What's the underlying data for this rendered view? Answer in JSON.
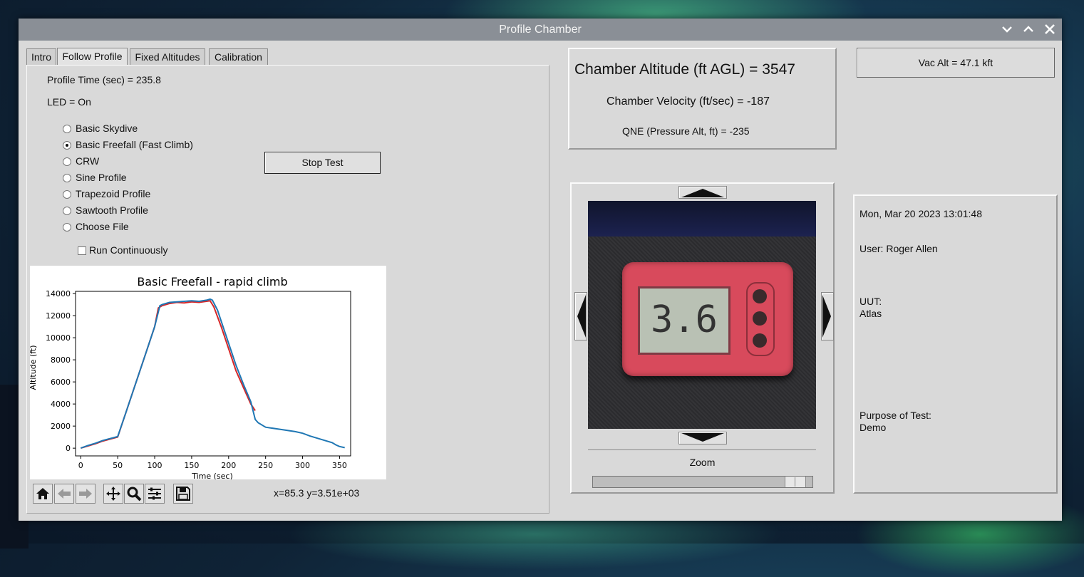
{
  "window": {
    "title": "Profile Chamber"
  },
  "tabs": [
    {
      "label": "Intro"
    },
    {
      "label": "Follow Profile"
    },
    {
      "label": "Fixed Altitudes"
    },
    {
      "label": "Calibration"
    }
  ],
  "profile": {
    "time_text": "Profile Time (sec) = 235.8",
    "led_text": "LED = On",
    "options": [
      "Basic Skydive",
      "Basic Freefall (Fast Climb)",
      "CRW",
      "Sine Profile",
      "Trapezoid Profile",
      "Sawtooth Profile",
      "Choose File"
    ],
    "selected_index": 1,
    "run_continuously_label": "Run Continuously",
    "run_continuously_checked": false,
    "stop_button": "Stop Test"
  },
  "chart_data": {
    "type": "line",
    "title": "Basic Freefall - rapid climb",
    "xlabel": "Time (sec)",
    "ylabel": "Altitude (ft)",
    "xlim": [
      -7,
      365
    ],
    "ylim": [
      -700,
      14200
    ],
    "xticks": [
      0,
      50,
      100,
      150,
      200,
      250,
      300,
      350
    ],
    "yticks": [
      0,
      2000,
      4000,
      6000,
      8000,
      10000,
      12000,
      14000
    ],
    "series": [
      {
        "color": "#d62728",
        "x": [
          0,
          10,
          20,
          30,
          50,
          60,
          70,
          80,
          90,
          100,
          105,
          110,
          120,
          130,
          140,
          150,
          160,
          170,
          175,
          180,
          190,
          200,
          210,
          220,
          230,
          236
        ],
        "y": [
          0,
          200,
          400,
          650,
          1000,
          3000,
          5000,
          7000,
          9000,
          11000,
          12700,
          12900,
          13100,
          13200,
          13150,
          13250,
          13200,
          13300,
          13350,
          12800,
          11000,
          9000,
          7000,
          5500,
          4000,
          3400
        ]
      },
      {
        "color": "#1f77b4",
        "x": [
          0,
          10,
          20,
          30,
          50,
          60,
          70,
          80,
          90,
          100,
          107,
          110,
          120,
          130,
          140,
          150,
          160,
          170,
          175,
          178,
          185,
          190,
          200,
          210,
          220,
          230,
          236,
          240,
          250,
          270,
          290,
          300,
          310,
          320,
          330,
          340,
          345,
          350,
          357
        ],
        "y": [
          0,
          250,
          450,
          700,
          1050,
          3000,
          5000,
          7000,
          9000,
          11000,
          12900,
          13000,
          13200,
          13250,
          13300,
          13350,
          13300,
          13400,
          13500,
          13400,
          12500,
          11500,
          9500,
          7500,
          5800,
          4200,
          2600,
          2300,
          1900,
          1700,
          1500,
          1350,
          1100,
          900,
          700,
          500,
          300,
          150,
          50
        ]
      }
    ]
  },
  "plot_toolbar": {
    "coords": "x=85.3 y=3.51e+03",
    "tools": [
      "home-icon",
      "back-arrow-icon",
      "forward-arrow-icon",
      "pan-icon",
      "zoom-icon",
      "configure-subplots-icon",
      "save-icon"
    ]
  },
  "chamber": {
    "altitude_text": "Chamber Altitude (ft AGL) =  3547",
    "velocity_text": "Chamber Velocity (ft/sec) =  -187",
    "qne_text": "QNE (Pressure Alt, ft) = -235"
  },
  "vac_alt_button": "Vac Alt = 47.1 kft",
  "camera": {
    "display_value": "3.6",
    "zoom_label": "Zoom",
    "zoom_value": 0.96
  },
  "session": {
    "datetime": "Mon, Mar 20 2023   13:01:48",
    "user": "User: Roger Allen",
    "uut_label": "UUT:",
    "uut_value": "Atlas",
    "purpose_label": "Purpose of Test:",
    "purpose_value": "Demo"
  }
}
